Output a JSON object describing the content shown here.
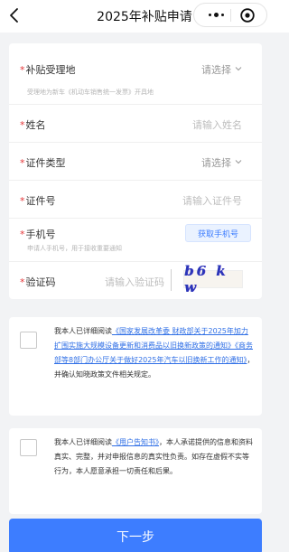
{
  "nav": {
    "title": "2025年补贴申请",
    "back_icon": "chevron-left-icon",
    "more_icon": "more-dots-icon",
    "close_icon": "target-circle-icon"
  },
  "form": {
    "fields": [
      {
        "label": "补贴受理地",
        "required": true,
        "value": "请选择",
        "hint": "受理地为新车《机动车销售统一发票》开具地",
        "icon": "chevron-down-icon"
      },
      {
        "label": "姓名",
        "required": true,
        "placeholder": "请输入姓名"
      },
      {
        "label": "证件类型",
        "required": true,
        "value": "请选择",
        "icon": "chevron-down-icon"
      },
      {
        "label": "证件号",
        "required": true,
        "placeholder": "请输入证件号"
      },
      {
        "label": "手机号",
        "required": true,
        "hint": "申请人手机号，用于接收重要通知",
        "button": "获取手机号"
      },
      {
        "label": "验证码",
        "required": true,
        "placeholder": "请输入验证码",
        "captcha": "b6 k w"
      }
    ],
    "required_mark": "*"
  },
  "agreement1": {
    "prefix": "我本人已详细阅读",
    "link1": "《国家发展改革委 财政部关于2025年加力扩围实施大规模设备更新和消费品以旧换新政策的通知》",
    "link2": "《商务部等8部门办公厅关于做好2025年汽车以旧换新工作的通知》",
    "suffix": "，并确认知晓政策文件相关规定。"
  },
  "agreement2": {
    "prefix": "我本人已详细阅读",
    "link": "《用户告知书》",
    "suffix": "，本人承诺提供的信息和资料真实、完整，并对申报信息的真实性负责。如存在虚假不实等行为，本人愿意承担一切责任和后果。"
  },
  "next_button": "下一步",
  "colors": {
    "primary": "#3d7dff",
    "required": "#e5383b",
    "link": "#2f6fe6",
    "background": "#f2f3f5"
  }
}
